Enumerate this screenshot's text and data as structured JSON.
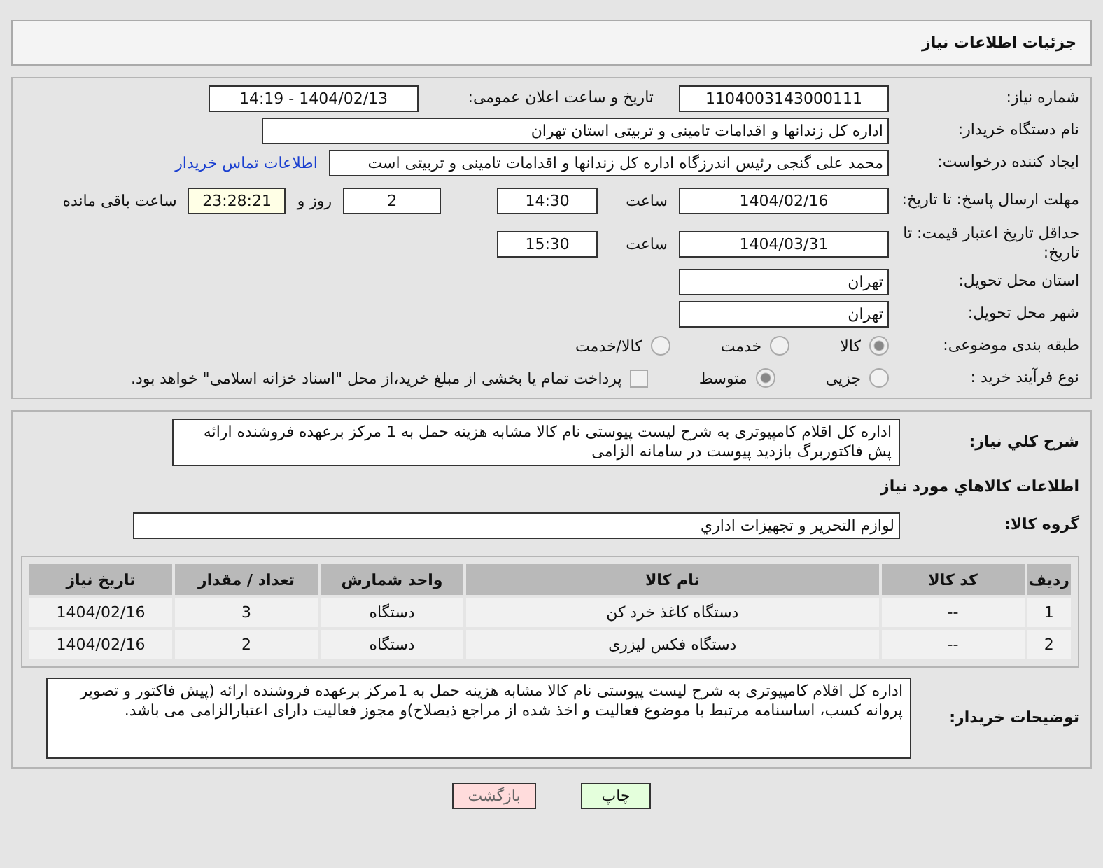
{
  "title": "جزئیات اطلاعات نیاز",
  "need_number": {
    "label": "شماره نیاز:",
    "value": "1104003143000111"
  },
  "announce": {
    "label": "تاریخ و ساعت اعلان عمومی:",
    "value": "1404/02/13 - 14:19"
  },
  "buyer": {
    "label": "نام دستگاه خریدار:",
    "value": "اداره کل زندانها و اقدامات تامینی و تربیتی استان تهران"
  },
  "requester": {
    "label": "ایجاد کننده درخواست:",
    "value": "محمد علی گنجی رئیس اندرزگاه  اداره کل زندانها و اقدامات تامینی و تربیتی است",
    "link": "اطلاعات تماس خریدار"
  },
  "deadline": {
    "label": "مهلت ارسال پاسخ: تا تاریخ:",
    "date": "1404/02/16",
    "time_label": "ساعت",
    "time": "14:30",
    "days": "2",
    "days_label": "روز و",
    "remaining": "23:28:21",
    "remaining_label": "ساعت باقی مانده"
  },
  "validity": {
    "label": "حداقل تاریخ اعتبار قیمت: تا تاریخ:",
    "date": "1404/03/31",
    "time_label": "ساعت",
    "time": "15:30"
  },
  "province": {
    "label": "استان محل تحویل:",
    "value": "تهران"
  },
  "city": {
    "label": "شهر محل تحویل:",
    "value": "تهران"
  },
  "category": {
    "label": "طبقه بندی موضوعی:",
    "options": [
      {
        "label": "کالا",
        "selected": true
      },
      {
        "label": "خدمت",
        "selected": false
      },
      {
        "label": "کالا/خدمت",
        "selected": false
      }
    ]
  },
  "process": {
    "label": "نوع فرآیند خرید :",
    "options": [
      {
        "label": "جزیی",
        "selected": false
      },
      {
        "label": "متوسط",
        "selected": true
      }
    ],
    "payment": {
      "checked": false,
      "text": "پرداخت تمام یا بخشی از مبلغ خرید،از محل \"اسناد خزانه اسلامی\" خواهد بود."
    }
  },
  "description": {
    "label": "شرح کلي نياز:",
    "value": "اداره کل اقلام کامپیوتری به شرح لیست پیوستی نام کالا مشابه هزینه حمل به 1 مرکز برعهده فروشنده ارائه پش فاکتوربرگ بازدید پیوست در سامانه الزامی"
  },
  "goods_heading": "اطلاعات کالاهاي مورد نياز",
  "goods_group": {
    "label": "گروه کالا:",
    "value": "لوازم التحرير و تجهيزات اداري"
  },
  "table": {
    "columns": [
      "رديف",
      "کد کالا",
      "نام کالا",
      "واحد شمارش",
      "تعداد / مقدار",
      "تاريخ نياز"
    ],
    "rows": [
      [
        "1",
        "--",
        "دستگاه کاغذ خرد کن",
        "دستگاه",
        "3",
        "1404/02/16"
      ],
      [
        "2",
        "--",
        "دستگاه فکس لیزری",
        "دستگاه",
        "2",
        "1404/02/16"
      ]
    ]
  },
  "buyer_notes": {
    "label": "توضیحات خریدار:",
    "value": "اداره کل اقلام کامپیوتری  به شرح لیست پیوستی نام کالا مشابه هزینه حمل به 1مرکز برعهده فروشنده ارائه (پیش فاکتور و تصویر پروانه کسب، اساسنامه مرتبط با موضوع فعالیت و اخذ شده از مراجع ذیصلاح)و مجوز فعالیت دارای اعتبارالزامی می باشد."
  },
  "buttons": [
    {
      "kind": "print",
      "label": "چاپ"
    },
    {
      "kind": "back",
      "label": "بازگشت"
    }
  ]
}
